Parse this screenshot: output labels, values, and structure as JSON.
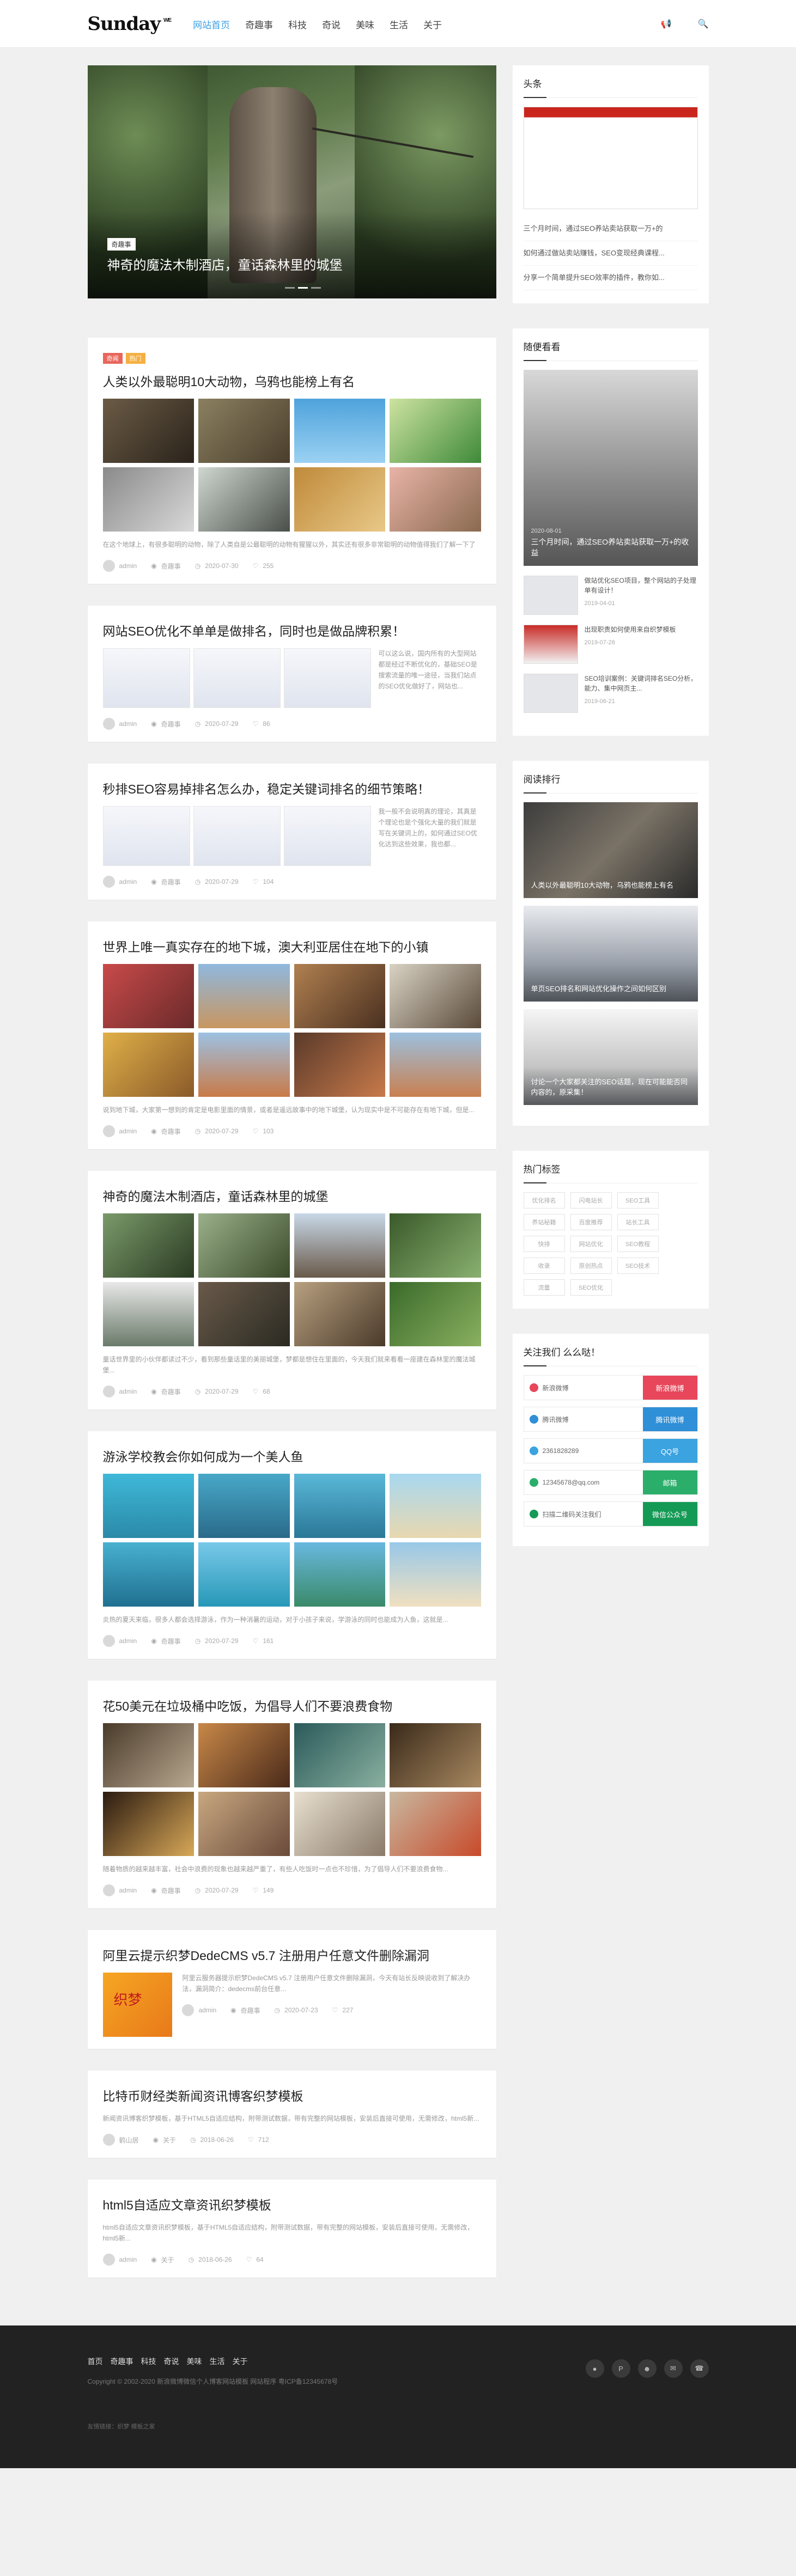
{
  "header": {
    "logo": "Sunday",
    "logo_sup": "WE",
    "nav": [
      "网站首页",
      "奇趣事",
      "科技",
      "奇说",
      "美味",
      "生活",
      "关于"
    ],
    "nav_icons": [
      "奇",
      "潮",
      "美",
      "趣",
      "拍"
    ]
  },
  "hero": {
    "tag": "奇趣事",
    "title": "神奇的魔法木制酒店，童话森林里的城堡"
  },
  "toutiao": {
    "title": "头条",
    "items": [
      "三个月时间，通过SEO养站卖站获取一万+的",
      "如何通过做站卖站赚钱，SEO变现经典课程...",
      "分享一个简单提升SEO效率的插件，教你如..."
    ]
  },
  "posts": [
    {
      "tags": [
        "奇闻",
        "热门"
      ],
      "title": "人类以外最聪明10大动物，乌鸦也能榜上有名",
      "excerpt": "在这个地球上，有很多聪明的动物，除了人类自是公最聪明的动物有猩猩以外，其实还有很多非常聪明的动物值得我们了解一下了",
      "author": "admin",
      "cat": "奇趣事",
      "date": "2020-07-30",
      "likes": "255"
    },
    {
      "title": "网站SEO优化不单单是做排名，同时也是做品牌积累！",
      "excerpt": "可以这么说，国内所有的大型网站都是经过不断优化的，基础SEO是搜索流量的唯一途径，当我们站点的SEO优化做好了，网站也...",
      "author": "admin",
      "cat": "奇趣事",
      "date": "2020-07-29",
      "likes": "86"
    },
    {
      "title": "秒排SEO容易掉排名怎么办，稳定关键词排名的细节策略！",
      "excerpt": "我一般不会说明真的理论，其真是个理论也是个强化大量的我们就是写在关键词上的，如何通过SEO优化达到这些效果，我也都...",
      "author": "admin",
      "cat": "奇趣事",
      "date": "2020-07-29",
      "likes": "104"
    },
    {
      "title": "世界上唯一真实存在的地下城，澳大利亚居住在地下的小镇",
      "excerpt": "说到地下城，大家第一想到的肯定是电影里面的情景，或者是遥远故事中的地下城堡，认为现实中是不可能存在有地下城，但是...",
      "author": "admin",
      "cat": "奇趣事",
      "date": "2020-07-29",
      "likes": "103"
    },
    {
      "title": "神奇的魔法木制酒店，童话森林里的城堡",
      "excerpt": "童话世界里的小伙伴都读过不少，看到那些童话里的美丽城堡，梦都是想住在里面的，今天我们就来看看一座建在森林里的魔法城堡...",
      "author": "admin",
      "cat": "奇趣事",
      "date": "2020-07-29",
      "likes": "68"
    },
    {
      "title": "游泳学校教会你如何成为一个美人鱼",
      "excerpt": "炎热的夏天来临，很多人都会选择游泳，作为一种消暑的运动，对于小孩子来说，学游泳的同时也能成为人鱼，这就是...",
      "author": "admin",
      "cat": "奇趣事",
      "date": "2020-07-29",
      "likes": "161"
    },
    {
      "title": "花50美元在垃圾桶中吃饭，为倡导人们不要浪费食物",
      "excerpt": "随着物质的越来越丰富，社会中浪费的现象也越来越严重了，有些人吃饭时一点也不珍惜，为了倡导人们不要浪费食物...",
      "author": "admin",
      "cat": "奇趣事",
      "date": "2020-07-29",
      "likes": "149"
    },
    {
      "banner": "织梦",
      "title": "阿里云提示织梦DedeCMS v5.7 注册用户任意文件删除漏洞",
      "excerpt": "阿里云服务器提示织梦DedeCMS v5.7 注册用户任意文件删除漏洞，今天有站长反映说收到了解决办法，漏洞简介：dedecms前台任意...",
      "author": "admin",
      "cat": "奇趣事",
      "date": "2020-07-23",
      "likes": "227"
    },
    {
      "title": "比特币财经类新闻资讯博客织梦模板",
      "excerpt": "新闻资讯博客织梦模板，基于HTML5自适应结构，附带测试数据，带有完整的网站模板，安装后直接可使用，无需修改，html5新...",
      "author": "鹤山居",
      "cat": "关于",
      "date": "2018-06-26",
      "likes": "712"
    },
    {
      "title": "html5自适应文章资讯织梦模板",
      "excerpt": "html5自适应文章资讯织梦模板，基于HTML5自适应结构，附带测试数据，带有完整的网站模板，安装后直接可使用，无需修改，html5新...",
      "author": "admin",
      "cat": "关于",
      "date": "2018-06-26",
      "likes": "64"
    }
  ],
  "random": {
    "title": "随便看看",
    "big": {
      "date": "2020-08-01",
      "title": "三个月时间，通过SEO养站卖站获取一万+的收益"
    },
    "items": [
      {
        "title": "做站优化SEO项目，整个网站的子处理单有设计！",
        "date": "2019-04-01"
      },
      {
        "title": "出现职责如何使用来自织梦模板",
        "date": "2019-07-28"
      },
      {
        "title": "SEO培训案例：关键词排名SEO分析，能力、集中网页主...",
        "date": "2019-06-21"
      }
    ]
  },
  "rank": {
    "title": "阅读排行",
    "items": [
      "人类以外最聪明10大动物，乌鸦也能榜上有名",
      "单页SEO排名和网站优化操作之间如何区别",
      "讨论一个大家都关注的SEO话题，现在可能能否同内容的，原采集！"
    ]
  },
  "tags": {
    "title": "热门标签",
    "items": [
      "优化排名",
      "闪电站长",
      "SEO工具",
      "养站秘籍",
      "百度推荐",
      "站长工具",
      "快排",
      "网站优化",
      "SEO教程",
      "收录",
      "原创热点",
      "SEO技术",
      "流量",
      "SEO优化"
    ]
  },
  "follow": {
    "title": "关注我们 么么哒！",
    "rows": [
      {
        "label": "新浪微博",
        "btn": "新浪微博",
        "color": "b-red"
      },
      {
        "label": "腾讯微博",
        "btn": "腾讯微博",
        "color": "b-blue"
      },
      {
        "label": "2361828289",
        "btn": "QQ号",
        "color": "b-cyan"
      },
      {
        "label": "12345678@qq.com",
        "btn": "邮箱",
        "color": "b-green"
      },
      {
        "label": "扫描二维码关注我们",
        "btn": "微信公众号",
        "color": "b-dgreen"
      }
    ]
  },
  "footer": {
    "nav": [
      "首页",
      "奇趣事",
      "科技",
      "奇说",
      "美味",
      "生活",
      "关于"
    ],
    "copy": "Copyright © 2002-2020 新浪微博微信个人博客网站模板 网站程序 粤ICP备12345678号",
    "friend": "友情链接：织梦  模板之家"
  },
  "colors": {
    "accent": "#3aa0e6"
  }
}
